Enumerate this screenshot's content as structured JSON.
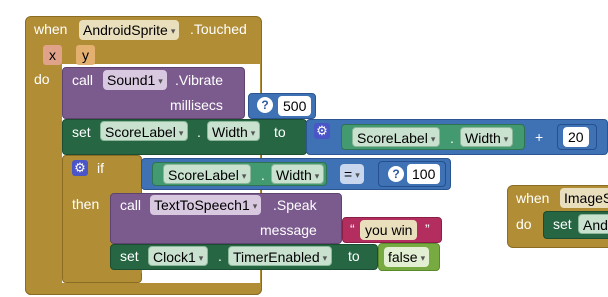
{
  "event": {
    "when_label": "when",
    "component": "AndroidSprite",
    "event_name": ".Touched",
    "params": [
      "x",
      "y"
    ],
    "do_label": "do"
  },
  "vibrate": {
    "call_label": "call",
    "component": "Sound1",
    "method": ".Vibrate",
    "arg_label": "millisecs",
    "value": "500"
  },
  "set_width": {
    "set_label": "set",
    "component": "ScoreLabel",
    "property": "Width",
    "dot": ".",
    "to_label": "to",
    "get_component": "ScoreLabel",
    "get_property": "Width",
    "operator": "+",
    "addend": "20"
  },
  "if_block": {
    "if_label": "if",
    "then_label": "then",
    "get_component": "ScoreLabel",
    "get_property": "Width",
    "compare_op": "=",
    "compare_value": "100"
  },
  "speak": {
    "call_label": "call",
    "component": "TextToSpeech1",
    "method": ".Speak",
    "arg_label": "message",
    "quote_open": "“",
    "text": "you win",
    "quote_close": "”"
  },
  "set_timer": {
    "set_label": "set",
    "component": "Clock1",
    "property": "TimerEnabled",
    "dot": ".",
    "to_label": "to",
    "value": "false"
  },
  "second_event": {
    "when_label": "when",
    "component_partial": "ImageS",
    "do_label": "do",
    "set_label": "set",
    "set_component_partial": "And"
  },
  "colors": {
    "event": "#b18e35",
    "procedure": "#7b5a8e",
    "setter": "#266643",
    "getter": "#439970",
    "math": "#3f71b5",
    "text": "#b32d5e",
    "logic": "#77ab41"
  }
}
